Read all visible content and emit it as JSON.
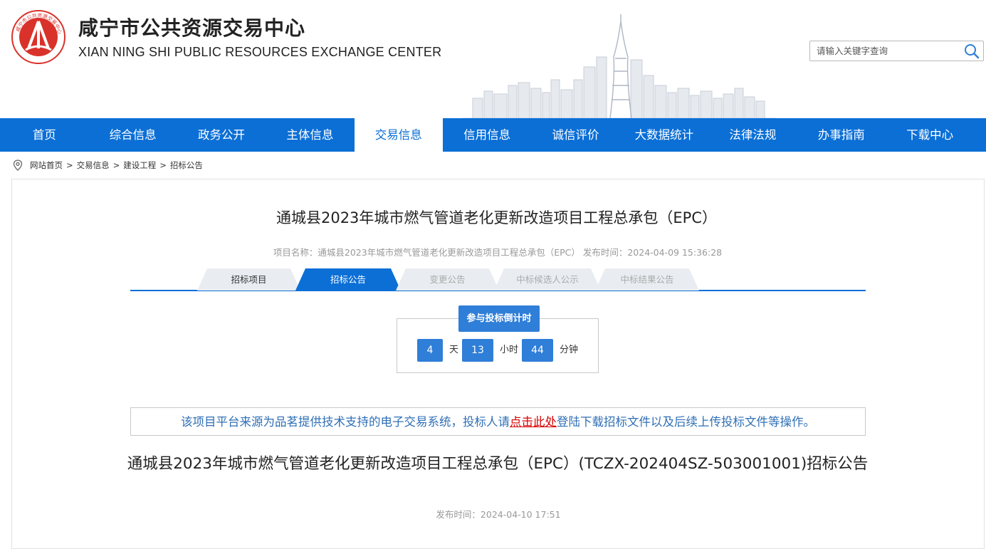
{
  "header": {
    "title": "咸宁市公共资源交易中心",
    "subtitle": "XIAN NING SHI PUBLIC RESOURCES EXCHANGE CENTER",
    "logo_icon": "emblem-logo",
    "logo_text": "咸宁市公共资源交易中心",
    "search": {
      "placeholder": "请输入关键字查询",
      "value": "",
      "icon": "search-icon"
    }
  },
  "nav": {
    "items": [
      {
        "label": "首页"
      },
      {
        "label": "综合信息"
      },
      {
        "label": "政务公开"
      },
      {
        "label": "主体信息"
      },
      {
        "label": "交易信息",
        "active": true
      },
      {
        "label": "信用信息"
      },
      {
        "label": "诚信评价"
      },
      {
        "label": "大数据统计"
      },
      {
        "label": "法律法规"
      },
      {
        "label": "办事指南"
      },
      {
        "label": "下载中心"
      }
    ]
  },
  "breadcrumb": {
    "icon": "location-pin-icon",
    "items": [
      "网站首页",
      "交易信息",
      "建设工程",
      "招标公告"
    ],
    "separator": ">"
  },
  "project": {
    "title": "通城县2023年城市燃气管道老化更新改造项目工程总承包（EPC）",
    "meta": "项目名称：通城县2023年城市燃气管道老化更新改造项目工程总承包（EPC） 发布时间：2024-04-09 15:36:28"
  },
  "tabs": [
    {
      "label": "招标项目",
      "state": "normal"
    },
    {
      "label": "招标公告",
      "state": "active"
    },
    {
      "label": "变更公告",
      "state": "disabled"
    },
    {
      "label": "中标候选人公示",
      "state": "disabled"
    },
    {
      "label": "中标结果公告",
      "state": "disabled"
    }
  ],
  "countdown": {
    "label": "参与投标倒计时",
    "days": "4",
    "days_unit": "天",
    "hours": "13",
    "hours_unit": "小时",
    "minutes": "44",
    "minutes_unit": "分钟"
  },
  "notice": {
    "before": "该项目平台来源为品茗提供技术支持的电子交易系统，投标人请",
    "link": "点击此处",
    "after": "登陆下载招标文件以及后续上传投标文件等操作。"
  },
  "article": {
    "title": "通城县2023年城市燃气管道老化更新改造项目工程总承包（EPC）(TCZX-202404SZ-503001001)招标公告",
    "date": "发布时间：2024-04-10 17:51"
  },
  "colors": {
    "primary": "#0b6fd6",
    "button": "#2f7ed8",
    "link_red": "#d80000",
    "notice_blue": "#2f6fb5",
    "logo_red": "#d9322b"
  }
}
